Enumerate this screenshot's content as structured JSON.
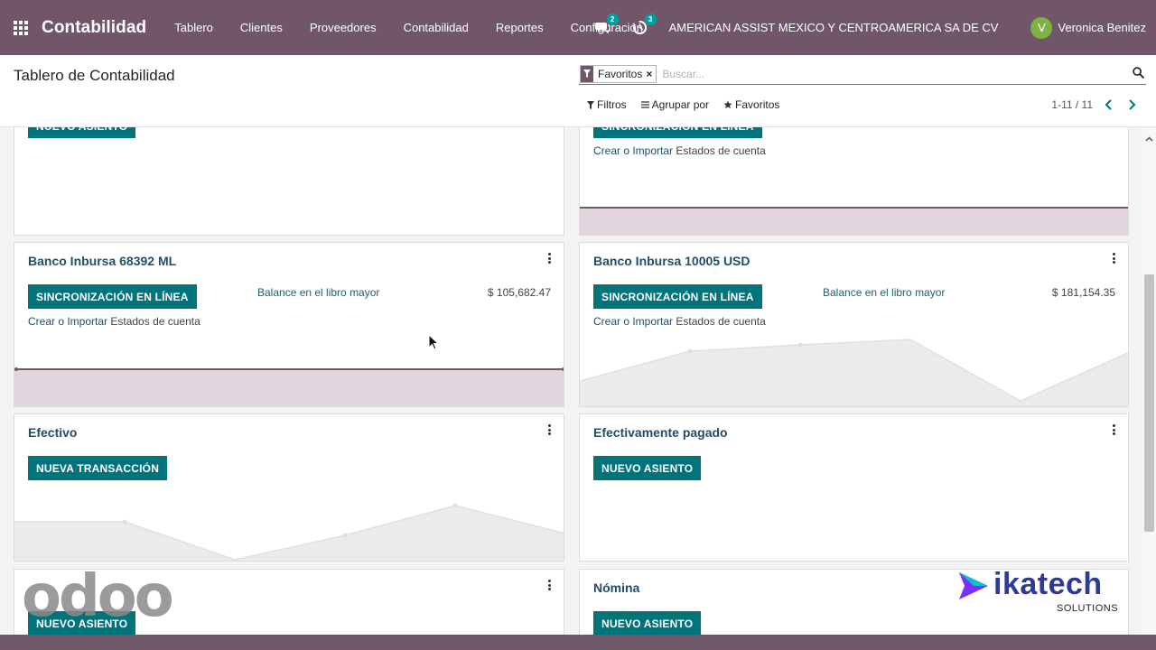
{
  "navbar": {
    "brand": "Contabilidad",
    "menu": [
      "Tablero",
      "Clientes",
      "Proveedores",
      "Contabilidad",
      "Reportes",
      "Configuración"
    ],
    "messages_count": "2",
    "activities_count": "3",
    "company": "AMERICAN ASSIST MEXICO Y CENTROAMERICA SA DE CV",
    "user_initial": "V",
    "user_name": "Veronica Benitez"
  },
  "control_panel": {
    "title": "Tablero de Contabilidad",
    "search": {
      "facet_label": "Favoritos",
      "facet_close": "×",
      "placeholder": "Buscar..."
    },
    "filters_label": "Filtros",
    "group_by_label": "Agrupar por",
    "favorites_label": "Favoritos",
    "pager": "1-11 / 11"
  },
  "cards": {
    "top_left": {
      "button": "NUEVO ASIENTO"
    },
    "top_right": {
      "button": "SINCRONIZACIÓN EN LÍNEA",
      "link_action": "Crear o Importar",
      "link_plain": "Estados de cuenta"
    },
    "inbursa_ml": {
      "title": "Banco Inbursa 68392 ML",
      "button": "SINCRONIZACIÓN EN LÍNEA",
      "balance_label": "Balance en el libro mayor",
      "balance_value": "$ 105,682.47",
      "link_action": "Crear o Importar",
      "link_plain": "Estados de cuenta"
    },
    "inbursa_usd": {
      "title": "Banco Inbursa 10005 USD",
      "button": "SINCRONIZACIÓN EN LÍNEA",
      "balance_label": "Balance en el libro mayor",
      "balance_value": "$ 181,154.35",
      "link_action": "Crear o Importar",
      "link_plain": "Estados de cuenta"
    },
    "efectivo": {
      "title": "Efectivo",
      "button": "NUEVA TRANSACCIÓN"
    },
    "efectivamente_pagado": {
      "title": "Efectivamente pagado",
      "button": "NUEVO ASIENTO"
    },
    "bottom_left": {
      "button": "NUEVO ASIENTO"
    },
    "nomina": {
      "title": "Nómina",
      "button": "NUEVO ASIENTO"
    }
  },
  "watermarks": {
    "odoo": "odoo",
    "ikatech": "ikatech",
    "ikatech_sub": "SOLUTIONS"
  },
  "colors": {
    "navbar": "#71566a",
    "primary_button": "#00737b",
    "title_text": "#1f4f66",
    "badge": "#00a09d"
  }
}
